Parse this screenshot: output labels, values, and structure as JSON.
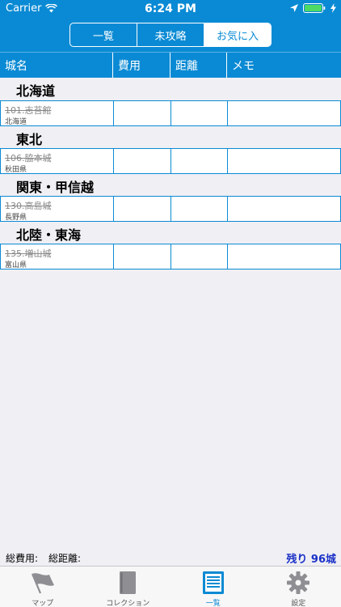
{
  "status": {
    "carrier": "Carrier",
    "time": "6:24 PM"
  },
  "segments": [
    {
      "label": "一覧",
      "active": false
    },
    {
      "label": "未攻略",
      "active": false
    },
    {
      "label": "お気に入",
      "active": true
    }
  ],
  "columns": [
    "城名",
    "費用",
    "距離",
    "メモ"
  ],
  "sections": [
    {
      "title": "北海道",
      "rows": [
        {
          "name": "101.志苔館",
          "pref": "北海道"
        }
      ]
    },
    {
      "title": "東北",
      "rows": [
        {
          "name": "106.脇本城",
          "pref": "秋田県"
        }
      ]
    },
    {
      "title": "関東・甲信越",
      "rows": [
        {
          "name": "130.高島城",
          "pref": "長野県"
        }
      ]
    },
    {
      "title": "北陸・東海",
      "rows": [
        {
          "name": "135.増山城",
          "pref": "富山県"
        }
      ]
    }
  ],
  "footer": {
    "total_cost": "総費用:",
    "total_distance": "総距離:",
    "remaining": "残り 96城"
  },
  "tabs": [
    {
      "label": "マップ",
      "icon": "flag-icon"
    },
    {
      "label": "コレクション",
      "icon": "book-icon"
    },
    {
      "label": "一覧",
      "icon": "list-icon"
    },
    {
      "label": "設定",
      "icon": "gear-icon"
    }
  ],
  "colors": {
    "accent": "#0a8ad4",
    "remaining": "#1a31c7"
  }
}
